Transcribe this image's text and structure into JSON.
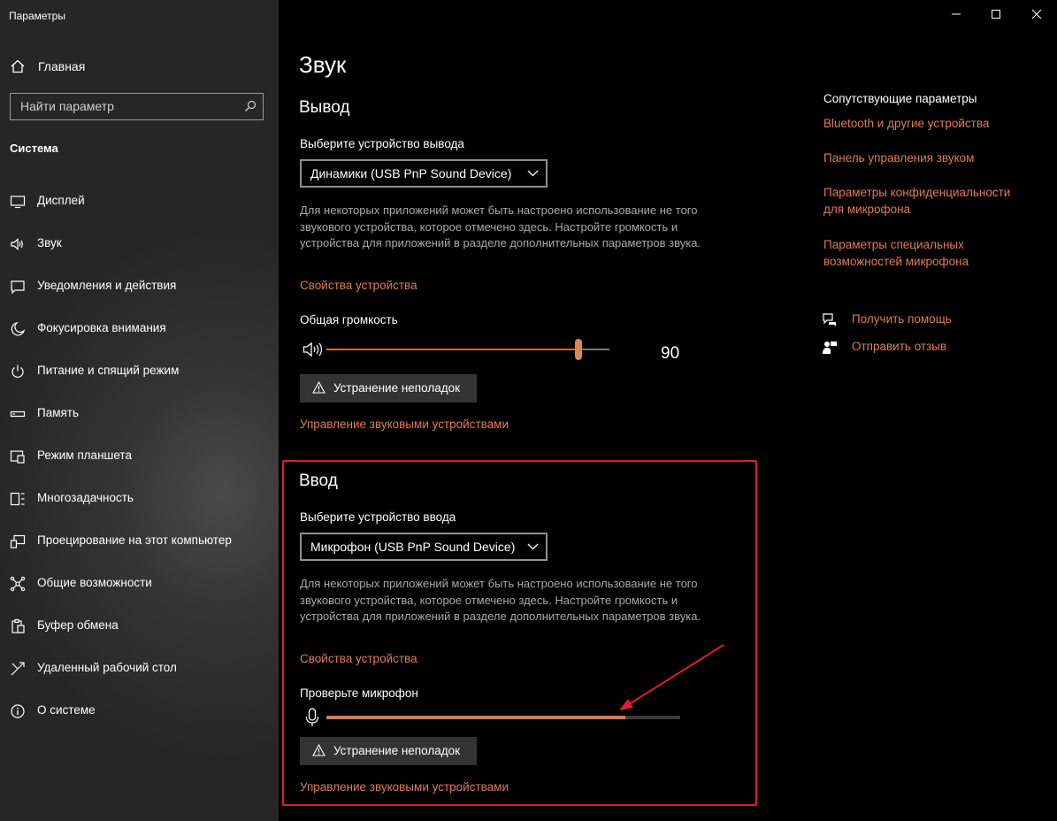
{
  "window": {
    "title": "Параметры"
  },
  "sidebar": {
    "home_label": "Главная",
    "search_placeholder": "Найти параметр",
    "section": "Система",
    "items": [
      {
        "label": "Дисплей",
        "icon": "monitor-icon"
      },
      {
        "label": "Звук",
        "icon": "speaker-icon"
      },
      {
        "label": "Уведомления и действия",
        "icon": "notification-icon"
      },
      {
        "label": "Фокусировка внимания",
        "icon": "moon-icon"
      },
      {
        "label": "Питание и спящий режим",
        "icon": "power-icon"
      },
      {
        "label": "Память",
        "icon": "storage-icon"
      },
      {
        "label": "Режим планшета",
        "icon": "tablet-icon"
      },
      {
        "label": "Многозадачность",
        "icon": "multitasking-icon"
      },
      {
        "label": "Проецирование на этот компьютер",
        "icon": "projection-icon"
      },
      {
        "label": "Общие возможности",
        "icon": "shared-experiences-icon"
      },
      {
        "label": "Буфер обмена",
        "icon": "clipboard-icon"
      },
      {
        "label": "Удаленный рабочий стол",
        "icon": "remote-desktop-icon"
      },
      {
        "label": "О системе",
        "icon": "info-icon"
      }
    ]
  },
  "main": {
    "title": "Звук",
    "output": {
      "heading": "Вывод",
      "device_label": "Выберите устройство вывода",
      "device_value": "Динамики (USB PnP Sound Device)",
      "desc": "Для некоторых приложений может быть настроено использование не того звукового устройства, которое отмечено здесь. Настройте громкость и устройства для приложений в разделе дополнительных параметров звука.",
      "properties_link": "Свойства устройства",
      "volume_label": "Общая громкость",
      "volume_value": "90",
      "volume_level": 0.89,
      "troubleshoot_label": "Устранение неполадок",
      "manage_link": "Управление звуковыми устройствами"
    },
    "input": {
      "heading": "Ввод",
      "device_label": "Выберите устройство ввода",
      "device_value": "Микрофон (USB PnP Sound Device)",
      "desc": "Для некоторых приложений может быть настроено использование не того звукового устройства, которое отмечено здесь. Настройте громкость и устройства для приложений в разделе дополнительных параметров звука.",
      "properties_link": "Свойства устройства",
      "test_label": "Проверьте микрофон",
      "mic_level": 0.845,
      "troubleshoot_label": "Устранение неполадок",
      "manage_link": "Управление звуковыми устройствами"
    }
  },
  "related": {
    "title": "Сопутствующие параметры",
    "links": [
      "Bluetooth и другие устройства",
      "Панель управления звуком",
      "Параметры конфиденциальности для микрофона",
      "Параметры специальных возможностей микрофона"
    ],
    "help_label": "Получить помощь",
    "feedback_label": "Отправить отзыв"
  },
  "colors": {
    "accent": "#e07a56",
    "highlight": "#e01e2b"
  }
}
